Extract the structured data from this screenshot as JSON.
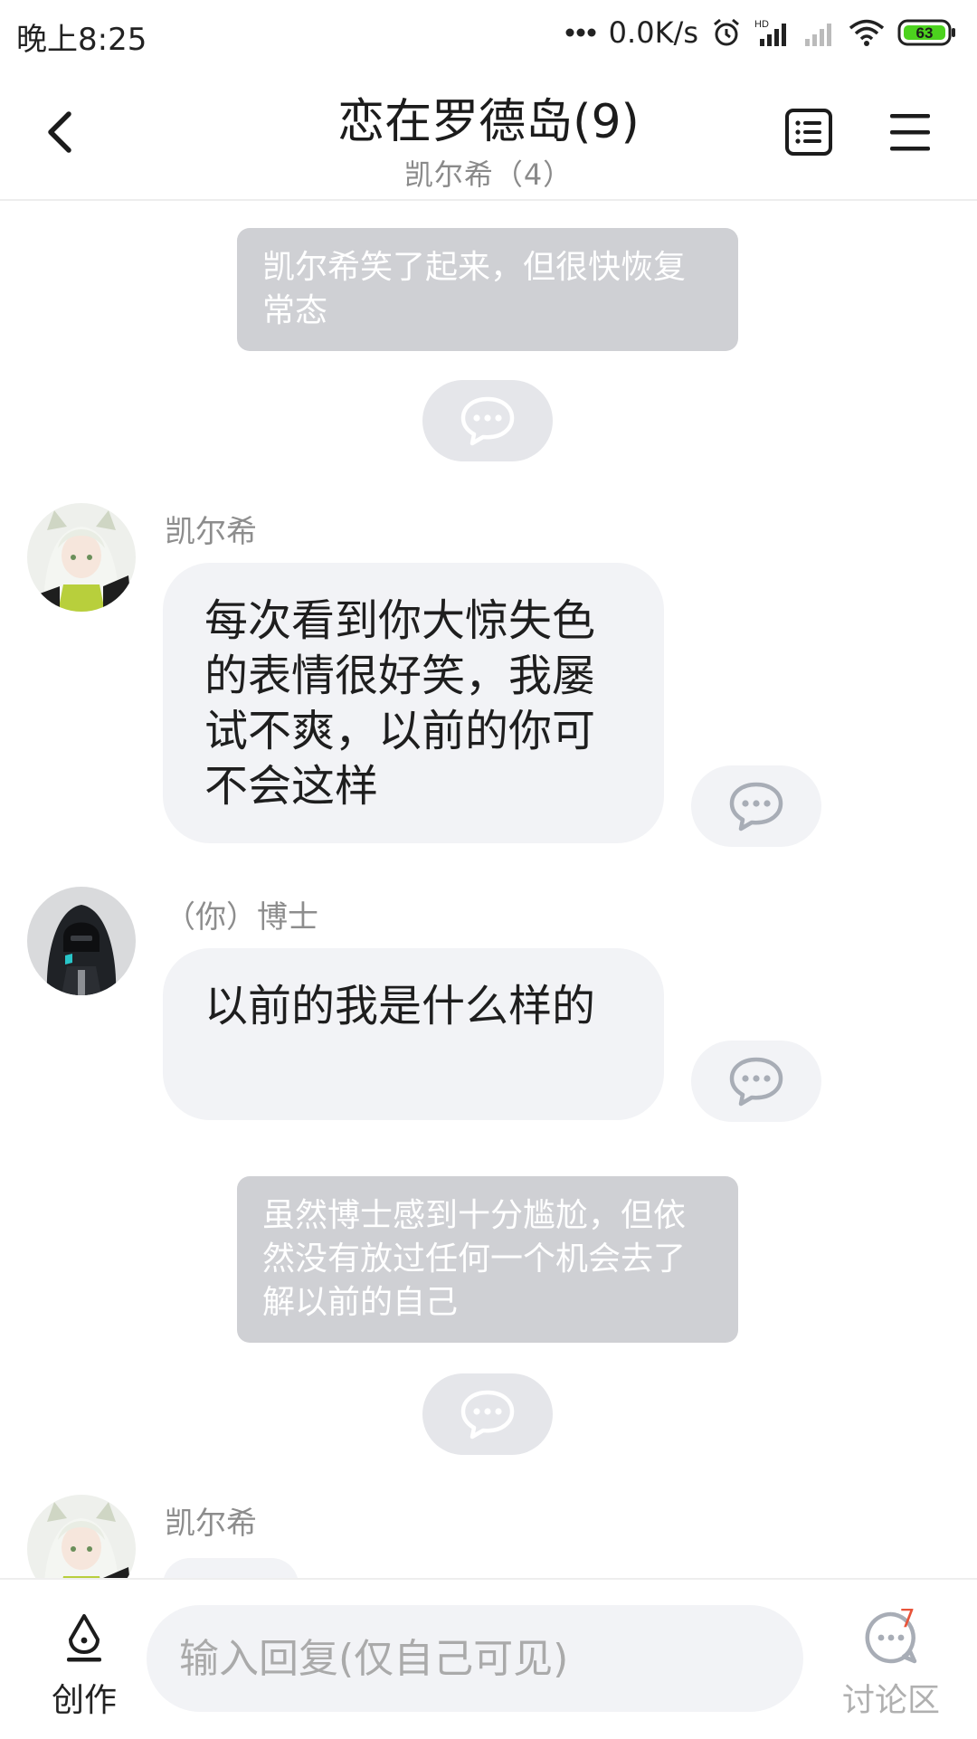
{
  "status_bar": {
    "time": "晚上8:25",
    "network_speed": "0.0K/s",
    "battery": "63",
    "icons": [
      "dots-icon",
      "alarm-icon",
      "hd-signal-icon",
      "signal-icon",
      "wifi-icon",
      "battery-icon"
    ]
  },
  "header": {
    "title": "恋在罗德岛(9)",
    "subtitle": "凯尔希（4）",
    "icons": [
      "back-icon",
      "chapter-list-icon",
      "menu-icon"
    ]
  },
  "messages": [
    {
      "type": "narration",
      "text": "凯尔希笑了起来，但很快恢复常态"
    },
    {
      "type": "speech",
      "speaker": "凯尔希",
      "text": "每次看到你大惊失色的表情很好笑，我屡试不爽，以前的你可不会这样"
    },
    {
      "type": "speech",
      "speaker": "（你）博士",
      "text": "以前的我是什么样的"
    },
    {
      "type": "narration",
      "text": "虽然博士感到十分尴尬，但依然没有放过任何一个机会去了解以前的自己"
    },
    {
      "type": "speech",
      "speaker": "凯尔希",
      "text": ""
    }
  ],
  "bottom_bar": {
    "create_label": "创作",
    "reply_placeholder": "输入回复(仅自己可见)",
    "discussion_label": "讨论区",
    "discussion_badge": "7"
  },
  "colors": {
    "narration_bg": "#cfd0d4",
    "bubble_bg": "#f2f3f6",
    "badge": "#e8543a"
  }
}
